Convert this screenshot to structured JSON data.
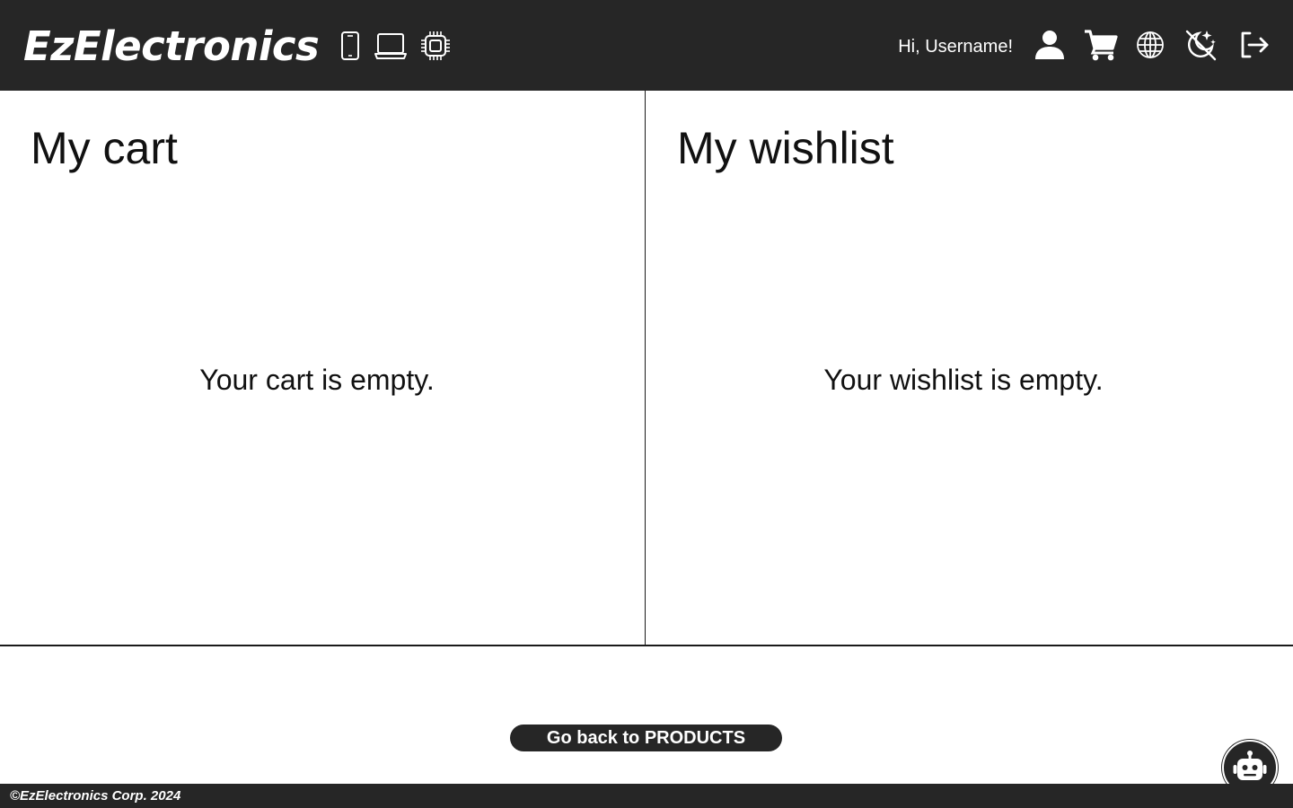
{
  "header": {
    "logo": "EzElectronics",
    "categories": [
      {
        "icon": "smartphone-icon"
      },
      {
        "icon": "laptop-icon"
      },
      {
        "icon": "chip-icon"
      }
    ],
    "greeting": "Hi, Username!",
    "actions": [
      {
        "icon": "user-icon"
      },
      {
        "icon": "cart-icon"
      },
      {
        "icon": "globe-icon"
      },
      {
        "icon": "theme-toggle-icon"
      },
      {
        "icon": "logout-icon"
      }
    ]
  },
  "cart": {
    "title": "My cart",
    "empty_message": "Your cart is empty."
  },
  "wishlist": {
    "title": "My wishlist",
    "empty_message": "Your wishlist is empty."
  },
  "back_button": {
    "label": "Go back to PRODUCTS"
  },
  "chatbot": {
    "icon": "robot-icon"
  },
  "footer": {
    "copyright": "©EzElectronics Corp. 2024"
  },
  "colors": {
    "dark": "#262626",
    "background": "#ffffff",
    "text": "#111111"
  }
}
